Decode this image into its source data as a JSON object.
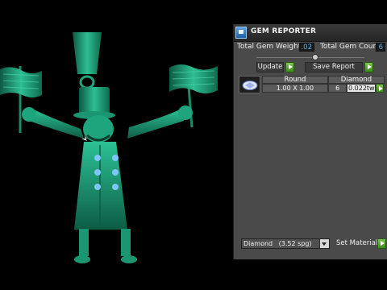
{
  "panel": {
    "title": "GEM REPORTER",
    "total_weight_label": "Total Gem Weight",
    "total_weight_value": ".02",
    "total_count_label": "Total Gem Count",
    "total_count_value": "6",
    "update_label": "Update",
    "save_report_label": "Save Report",
    "table": {
      "shape_header": "Round",
      "material_header": "Diamond",
      "size": "1.00 X 1.00",
      "count": "6",
      "weight": "0.022tw"
    },
    "material_select_value": "Diamond",
    "material_select_density": "(3.52 spg)",
    "set_material_label": "Set Material"
  },
  "colors": {
    "model_green": "#1fa57e",
    "accent_blue": "#5fb3e8",
    "go_green": "#5aad2e"
  },
  "icons": {
    "app": "gem-reporter-icon",
    "thumb": "round-gem-icon",
    "go": "go-arrow-icon",
    "dropdown": "chevron-down-icon"
  }
}
